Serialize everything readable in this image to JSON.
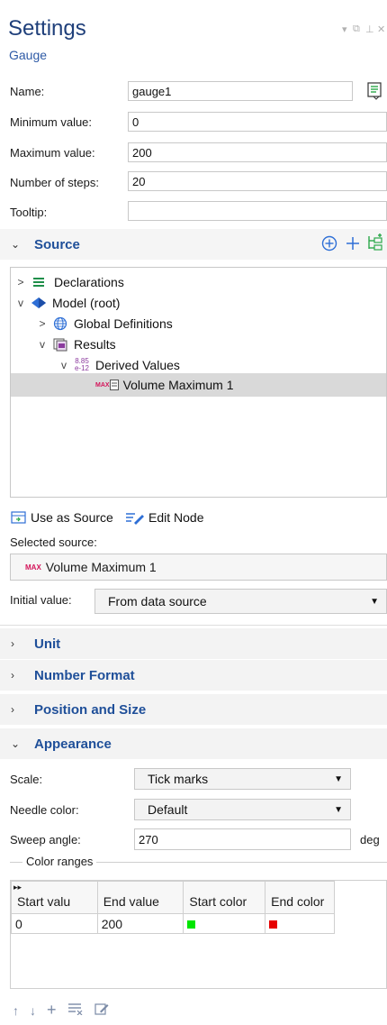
{
  "header": {
    "title": "Settings",
    "subtitle": "Gauge",
    "window_controls": [
      "▾",
      "⧉",
      "⊥",
      "✕"
    ]
  },
  "form": {
    "name_label": "Name:",
    "name_value": "gauge1",
    "min_label": "Minimum value:",
    "min_value": "0",
    "max_label": "Maximum value:",
    "max_value": "200",
    "steps_label": "Number of steps:",
    "steps_value": "20",
    "tooltip_label": "Tooltip:",
    "tooltip_value": ""
  },
  "source": {
    "section_label": "Source",
    "tree": [
      {
        "label": "Declarations",
        "icon": "list-lines-icon",
        "toggle": ">"
      },
      {
        "label": "Model (root)",
        "icon": "model-diamond-icon",
        "toggle": "v"
      },
      {
        "label": "Global Definitions",
        "icon": "globe-icon",
        "toggle": ">"
      },
      {
        "label": "Results",
        "icon": "results-icon",
        "toggle": "v"
      },
      {
        "label": "Derived Values",
        "icon": "derived-values-icon",
        "toggle": "v",
        "icon_text": [
          "8.85",
          "e-12"
        ]
      },
      {
        "label": "Volume Maximum 1",
        "icon": "max-table-icon",
        "icon_text": "MAX",
        "selected": true
      }
    ],
    "use_as_source": "Use as Source",
    "edit_node": "Edit Node",
    "selected_source_label": "Selected source:",
    "selected_source_badge": "MAX",
    "selected_source_value": "Volume Maximum 1",
    "initial_value_label": "Initial value:",
    "initial_value": "From data source"
  },
  "sections": {
    "unit": "Unit",
    "number_format": "Number Format",
    "position_size": "Position and Size",
    "appearance": "Appearance"
  },
  "appearance": {
    "scale_label": "Scale:",
    "scale_value": "Tick marks",
    "needle_label": "Needle color:",
    "needle_value": "Default",
    "sweep_label": "Sweep angle:",
    "sweep_value": "270",
    "sweep_unit": "deg",
    "color_ranges_label": "Color ranges",
    "table_headers": [
      "Start valu",
      "End value",
      "Start color",
      "End color"
    ],
    "rows": [
      {
        "start": "0",
        "end": "200",
        "start_color": "#00e600",
        "end_color": "#e60000"
      }
    ]
  },
  "colors": {
    "title": "#1f3f7a",
    "accent": "#2e6fd6",
    "section_text": "#1f4f99",
    "selection": "#d9d9d9",
    "green_add": "#2ba84a",
    "max_badge": "#d4145a"
  }
}
